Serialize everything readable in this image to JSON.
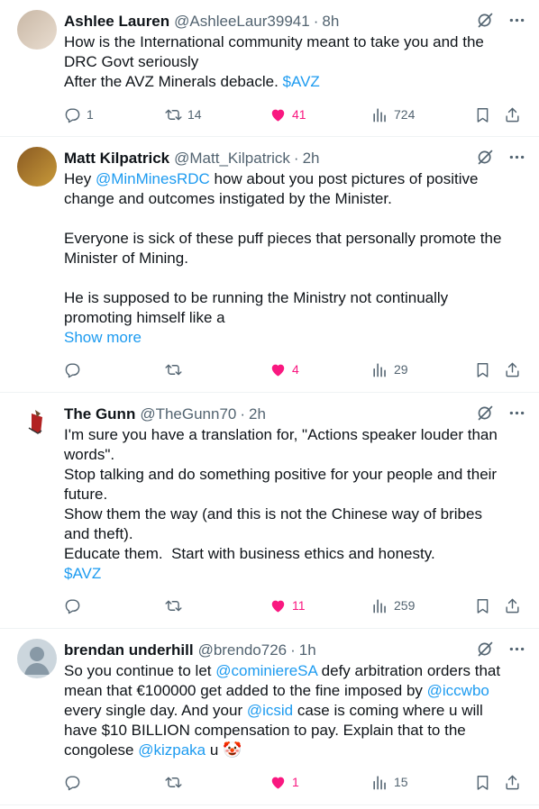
{
  "tweets": [
    {
      "name": "Ashlee Lauren",
      "handle": "@AshleeLaur39941",
      "time": "8h",
      "lines": [
        [
          {
            "t": "How is the International community meant to take you and the"
          }
        ],
        [
          {
            "t": "DRC Govt seriously"
          }
        ],
        [
          {
            "t": "After the AVZ Minerals debacle. "
          },
          {
            "t": "$AVZ",
            "link": true
          }
        ]
      ],
      "show_more": "",
      "replies": "1",
      "retweets": "14",
      "likes": "41",
      "views": "724",
      "avatar_colors": [
        "#c9b8a6",
        "#e9ddd0"
      ]
    },
    {
      "name": "Matt Kilpatrick",
      "handle": "@Matt_Kilpatrick",
      "time": "2h",
      "lines": [
        [
          {
            "t": "Hey "
          },
          {
            "t": "@MinMinesRDC",
            "link": true
          },
          {
            "t": " how about you post pictures of positive"
          }
        ],
        [
          {
            "t": "change and outcomes instigated by the Minister."
          }
        ],
        [
          {
            "t": ""
          }
        ],
        [
          {
            "t": "Everyone is sick of these puff pieces that personally promote the"
          }
        ],
        [
          {
            "t": "Minister of Mining."
          }
        ],
        [
          {
            "t": ""
          }
        ],
        [
          {
            "t": "He is supposed to be running the Ministry not continually"
          }
        ],
        [
          {
            "t": "promoting himself like a"
          }
        ]
      ],
      "show_more": "Show more",
      "replies": "",
      "retweets": "",
      "likes": "4",
      "views": "29",
      "avatar_colors": [
        "#8a5a22",
        "#c89a3a"
      ]
    },
    {
      "name": "The Gunn",
      "handle": "@TheGunn70",
      "time": "2h",
      "lines": [
        [
          {
            "t": "I'm sure you have a translation for, \"Actions speaker louder than"
          }
        ],
        [
          {
            "t": "words\"."
          }
        ],
        [
          {
            "t": "Stop talking and do something positive for your people and their"
          }
        ],
        [
          {
            "t": "future."
          }
        ],
        [
          {
            "t": "Show them the way (and this is not the Chinese way of bribes"
          }
        ],
        [
          {
            "t": "and theft)."
          }
        ],
        [
          {
            "t": "Educate them.  Start with business ethics and honesty."
          }
        ],
        [
          {
            "t": "$AVZ",
            "link": true
          }
        ]
      ],
      "show_more": "",
      "replies": "",
      "retweets": "",
      "likes": "11",
      "views": "259",
      "avatar_colors": [
        "#ffffff",
        "#b22222"
      ]
    },
    {
      "name": "brendan underhill",
      "handle": "@brendo726",
      "time": "1h",
      "lines": [
        [
          {
            "t": "So you continue to let "
          },
          {
            "t": "@cominiereSA",
            "link": true
          },
          {
            "t": " defy arbitration orders that"
          }
        ],
        [
          {
            "t": "mean that €100000 get added to the fine imposed by "
          },
          {
            "t": "@iccwbo",
            "link": true
          }
        ],
        [
          {
            "t": "every single day. And your "
          },
          {
            "t": "@icsid",
            "link": true
          },
          {
            "t": " case is coming where u will"
          }
        ],
        [
          {
            "t": "have $10 BILLION compensation to pay. Explain that to the"
          }
        ],
        [
          {
            "t": "congolese "
          },
          {
            "t": "@kizpaka",
            "link": true
          },
          {
            "t": " u "
          },
          {
            "t": "🤡",
            "emoji": true
          }
        ]
      ],
      "show_more": "",
      "replies": "",
      "retweets": "",
      "likes": "1",
      "views": "15",
      "avatar_colors": [
        "#ccd6dd",
        "#8899a6"
      ]
    }
  ],
  "colors": {
    "text": "#0f1419",
    "secondary": "#536471",
    "link": "#1d9bf0",
    "like": "#f91880",
    "divider": "#eff3f4"
  },
  "icons": {
    "reply": "reply-icon",
    "retweet": "retweet-icon",
    "like": "heart-icon",
    "views": "views-icon",
    "bookmark": "bookmark-icon",
    "share": "share-icon",
    "grok": "grok-icon",
    "more": "more-icon"
  }
}
